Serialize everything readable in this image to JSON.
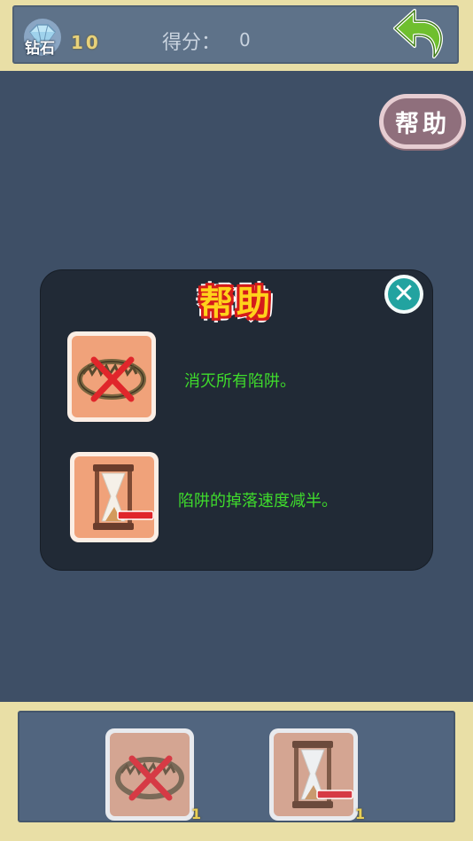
{
  "header": {
    "diamond_label": "钻石",
    "diamond_count": "10",
    "score_label": "得分：",
    "score_value": "0"
  },
  "help_button_label": "帮助",
  "dialog": {
    "title": "帮助",
    "items": [
      {
        "icon": "bear-trap-icon",
        "text": "消灭所有陷阱。"
      },
      {
        "icon": "hourglass-icon",
        "text": "陷阱的掉落速度减半。"
      }
    ]
  },
  "toolbar": {
    "tools": [
      {
        "icon": "bear-trap-icon",
        "count": "1"
      },
      {
        "icon": "hourglass-icon",
        "count": "1"
      }
    ]
  },
  "colors": {
    "background": "#3e4f66",
    "wood_frame": "#e9dfa6",
    "description_text": "#3fdc2c",
    "title_fill": "#ffd21b",
    "title_outline": "#d41b1b",
    "close_button": "#22a3a0"
  }
}
